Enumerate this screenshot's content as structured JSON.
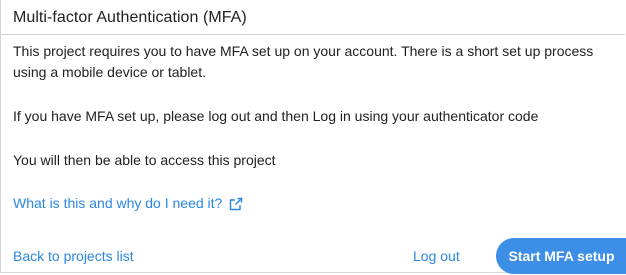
{
  "dialog": {
    "title": "Multi-factor Authentication (MFA)",
    "paragraphs": [
      "This project requires you to have MFA set up on your account. There is a short set up process using a mobile device or tablet.",
      "If you have MFA set up, please log out and then Log in using your authenticator code",
      "You will then be able to access this project"
    ],
    "help_link": {
      "label": "What is this and why do I need it?",
      "icon": "external-link-icon"
    },
    "back_link": "Back to projects list",
    "logout_label": "Log out",
    "start_label": "Start MFA setup"
  },
  "colors": {
    "link": "#2b86e0",
    "primary_button": "#3d8ee6",
    "text": "#212121",
    "divider": "#d0d0d0"
  }
}
